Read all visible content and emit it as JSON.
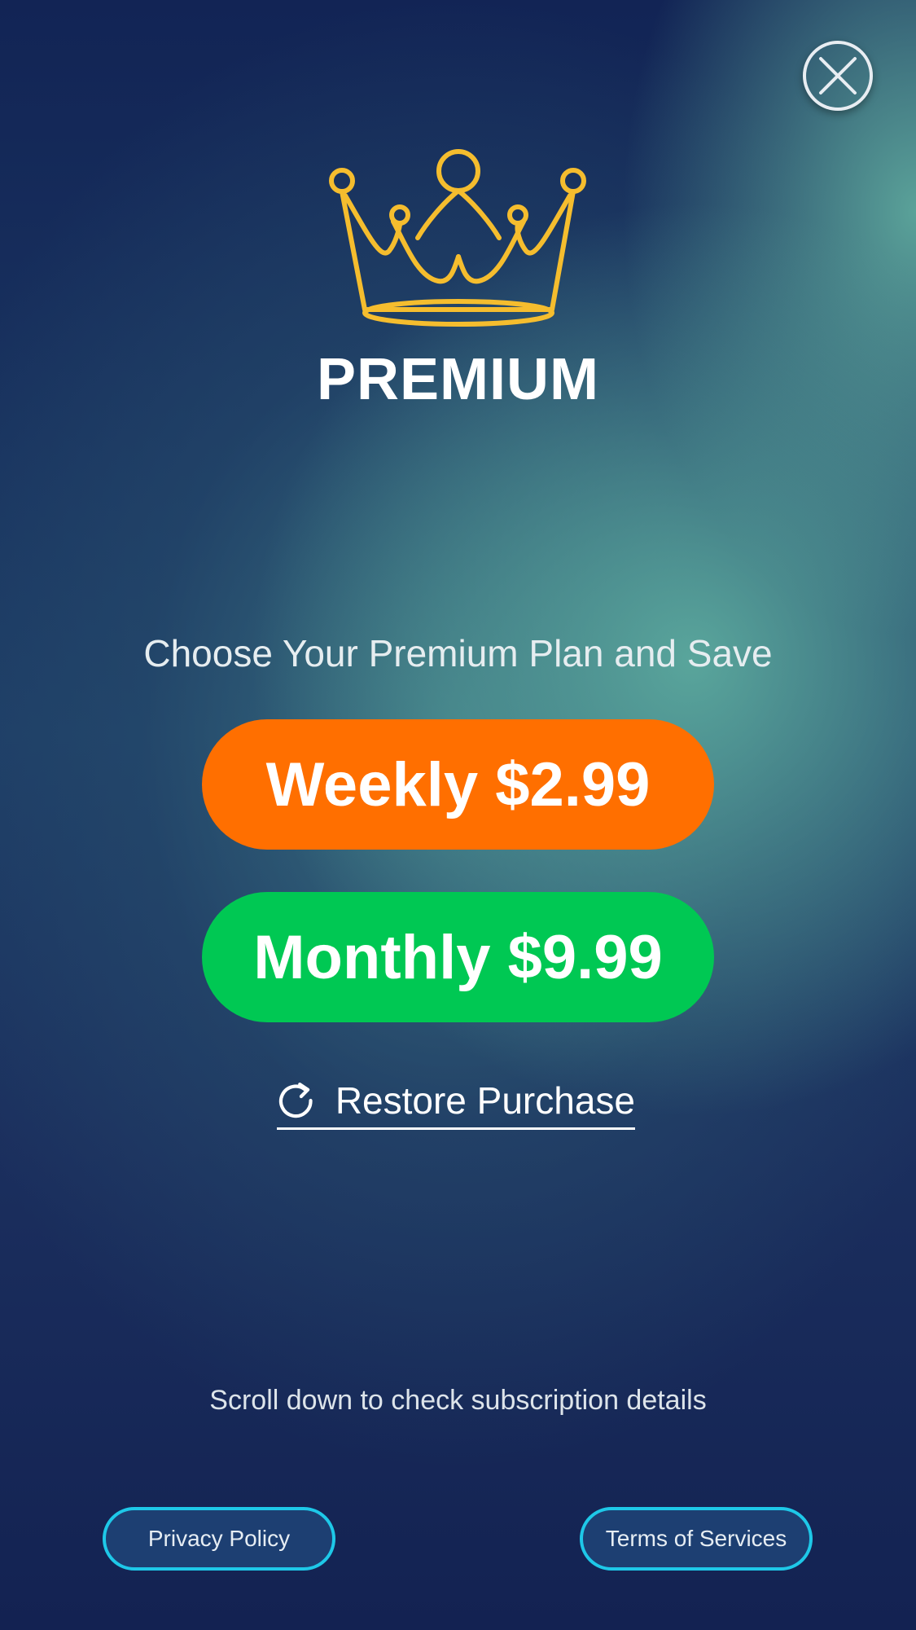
{
  "header": {
    "close_icon": "close-icon"
  },
  "hero": {
    "icon": "crown-icon",
    "title": "PREMIUM"
  },
  "plans": {
    "subtitle": "Choose Your Premium Plan and Save",
    "weekly_label": "Weekly $2.99",
    "monthly_label": "Monthly $9.99"
  },
  "restore": {
    "icon": "refresh-icon",
    "label": "Restore Purchase"
  },
  "footer": {
    "scroll_note": "Scroll down to check subscription details",
    "privacy_label": "Privacy Policy",
    "terms_label": "Terms of Services"
  },
  "colors": {
    "accent_crown": "#f5bd2e",
    "weekly_button": "#ff6f00",
    "monthly_button": "#00c853",
    "pill_border": "#1ec8e8"
  }
}
